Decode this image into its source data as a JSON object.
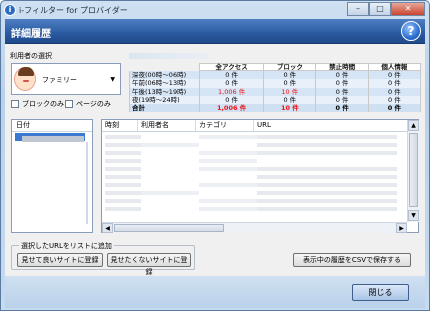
{
  "window": {
    "title": "i-フィルター for プロバイダー"
  },
  "header": {
    "title": "詳細履歴",
    "help_icon": "?"
  },
  "user_section": {
    "label": "利用者の選択",
    "selected_user": "ファミリー"
  },
  "checkboxes": {
    "block_only": "ブロックのみ",
    "page_only": "ページのみ"
  },
  "stats": {
    "columns": [
      "全アクセス",
      "ブロック",
      "禁止時間",
      "個人情報"
    ],
    "rows": [
      {
        "label": "深夜(00時〜06時)",
        "values": [
          "0 件",
          "0 件",
          "0 件",
          "0 件"
        ],
        "red": [
          false,
          false,
          false,
          false
        ]
      },
      {
        "label": "午前(06時〜13時)",
        "values": [
          "0 件",
          "0 件",
          "0 件",
          "0 件"
        ],
        "red": [
          false,
          false,
          false,
          false
        ]
      },
      {
        "label": "午後(13時〜19時)",
        "values": [
          "1,006 件",
          "10 件",
          "0 件",
          "0 件"
        ],
        "red": [
          true,
          true,
          false,
          false
        ]
      },
      {
        "label": "夜(19時〜24時)",
        "values": [
          "0 件",
          "0 件",
          "0 件",
          "0 件"
        ],
        "red": [
          false,
          false,
          false,
          false
        ]
      },
      {
        "label": "合計",
        "values": [
          "1,006 件",
          "10 件",
          "0 件",
          "0 件"
        ],
        "red": [
          true,
          true,
          false,
          false
        ]
      }
    ]
  },
  "date_list": {
    "header": "日付"
  },
  "history_list": {
    "columns": [
      "時刻",
      "利用者名",
      "カテゴリ",
      "URL"
    ]
  },
  "url_group": {
    "label": "選択したURLをリストに追加"
  },
  "buttons": {
    "add_good": "見せて良いサイトに登録",
    "add_bad": "見せたくないサイトに登録",
    "save_csv": "表示中の履歴をCSVで保存する",
    "close": "閉じる"
  }
}
